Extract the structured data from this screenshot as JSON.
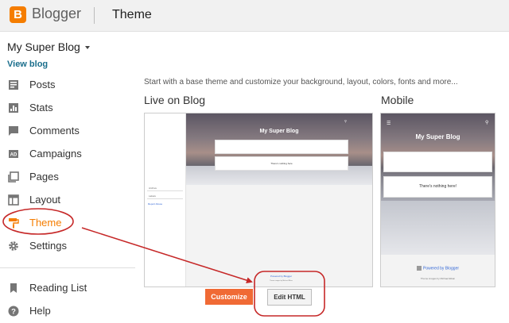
{
  "header": {
    "brand": "Blogger",
    "logo_letter": "B",
    "section_title": "Theme",
    "accent_color": "#f57d00"
  },
  "sidebar": {
    "blog_name": "My Super Blog",
    "view_blog": "View blog",
    "items": [
      {
        "label": "Posts",
        "icon": "posts-icon"
      },
      {
        "label": "Stats",
        "icon": "stats-icon"
      },
      {
        "label": "Comments",
        "icon": "comments-icon"
      },
      {
        "label": "Campaigns",
        "icon": "campaigns-icon"
      },
      {
        "label": "Pages",
        "icon": "pages-icon"
      },
      {
        "label": "Layout",
        "icon": "layout-icon"
      },
      {
        "label": "Theme",
        "icon": "theme-paint-roller-icon",
        "active": true
      },
      {
        "label": "Settings",
        "icon": "gear-icon"
      }
    ],
    "secondary_items": [
      {
        "label": "Reading List",
        "icon": "bookmark-icon"
      },
      {
        "label": "Help",
        "icon": "help-icon"
      }
    ]
  },
  "main": {
    "intro": "Start with a base theme and customize your background, layout, colors, fonts and more...",
    "live_heading": "Live on Blog",
    "mobile_heading": "Mobile",
    "preview": {
      "blog_title": "My Super Blog",
      "empty_message": "There's nothing here!",
      "desktop_empty_message": "There's nothing here",
      "sidebar_selects": [
        "Archive",
        "Labels"
      ],
      "sidebar_link": "Report Abuse",
      "powered_by": "Powered by Blogger",
      "theme_images": "Theme images by Michael Elkan"
    },
    "customize_button": "Customize",
    "edit_html_button": "Edit HTML"
  },
  "annotations": {
    "color": "#c62828"
  }
}
